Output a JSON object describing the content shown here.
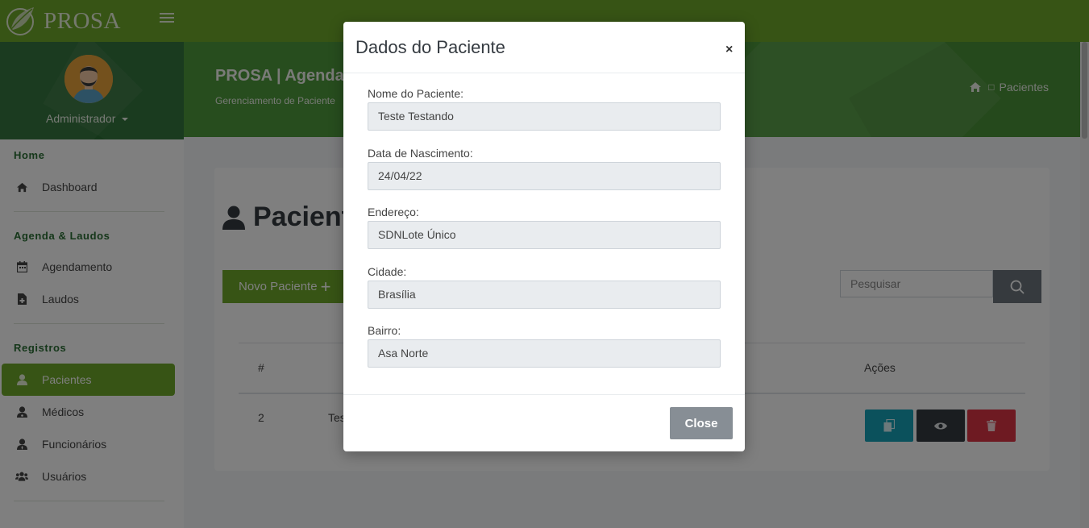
{
  "brand": {
    "name": "PROSA"
  },
  "user": {
    "name": "Administrador"
  },
  "sidebar": {
    "sections": [
      {
        "title": "Home",
        "items": [
          {
            "label": "Dashboard",
            "icon": "home-icon"
          }
        ]
      },
      {
        "title": "Agenda & Laudos",
        "items": [
          {
            "label": "Agendamento",
            "icon": "calendar-icon"
          },
          {
            "label": "Laudos",
            "icon": "file-medical-icon"
          }
        ]
      },
      {
        "title": "Registros",
        "items": [
          {
            "label": "Pacientes",
            "icon": "user-icon",
            "active": true
          },
          {
            "label": "Médicos",
            "icon": "user-doctor-icon"
          },
          {
            "label": "Funcionários",
            "icon": "user-tie-icon"
          },
          {
            "label": "Usuários",
            "icon": "users-icon"
          }
        ]
      }
    ]
  },
  "header": {
    "title": "PROSA | Agendam",
    "subtitle": "Gerenciamento de Paciente",
    "breadcrumb": {
      "separator": "□",
      "current": "Pacientes"
    }
  },
  "page": {
    "title": "Paciente",
    "new_button": "Novo Paciente",
    "new_button_icon": "+",
    "search_placeholder": "Pesquisar",
    "table": {
      "headers": {
        "index": "#",
        "actions": "Ações"
      },
      "rows": [
        {
          "index": "2",
          "name_partial": "Tes"
        }
      ]
    }
  },
  "modal": {
    "title": "Dados do Paciente",
    "close_symbol": "×",
    "fields": [
      {
        "label": "Nome do Paciente:",
        "value": "Teste Testando"
      },
      {
        "label": "Data de Nascimento:",
        "value": "24/04/22"
      },
      {
        "label": "Endereço:",
        "value": "SDNLote Único"
      },
      {
        "label": "Cidade:",
        "value": "Brasília"
      },
      {
        "label": "Bairro:",
        "value": "Asa Norte"
      }
    ],
    "close_button": "Close"
  },
  "colors": {
    "primary": "#6fa82b",
    "sidebar_header": "#2b6f35",
    "content_header": "#4f9a3d",
    "info": "#17a2b8",
    "dark": "#343a40",
    "danger": "#dc3545",
    "secondary": "#6c757d"
  }
}
